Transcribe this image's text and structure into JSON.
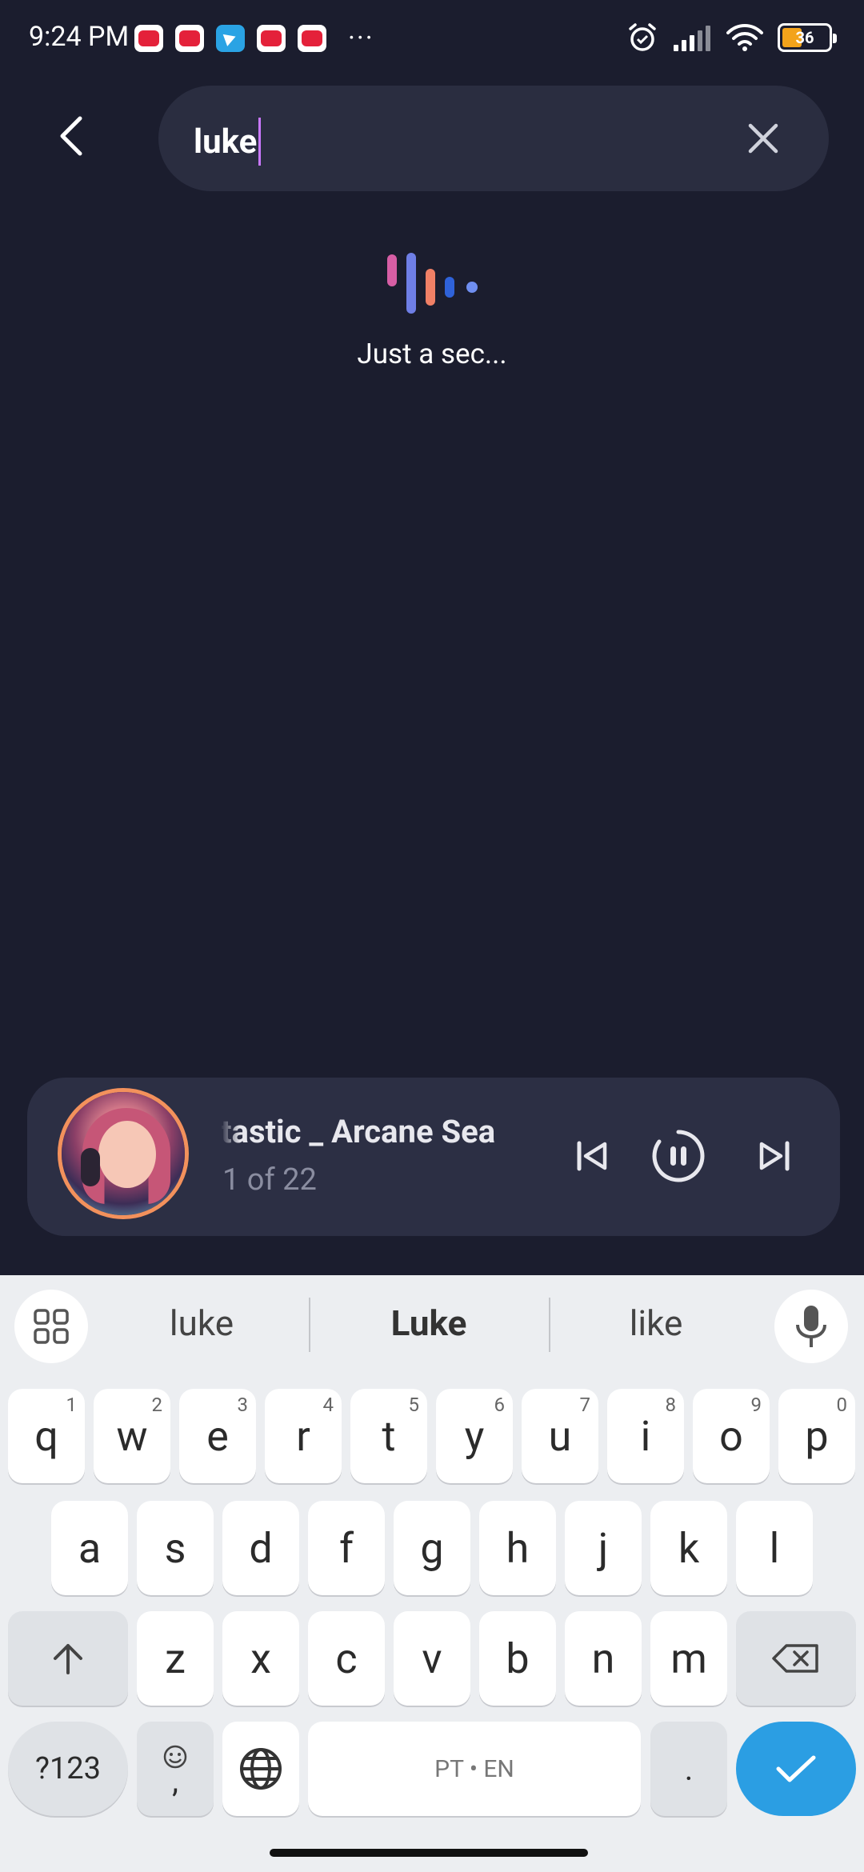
{
  "status_bar": {
    "time": "9:24 PM",
    "notifications": [
      "youtube-icon",
      "youtube-icon",
      "telegram-icon",
      "youtube-icon",
      "youtube-icon"
    ],
    "more": "···",
    "battery_level": "36"
  },
  "search": {
    "value": "luke"
  },
  "loading": {
    "text": "Just a sec..."
  },
  "player": {
    "track_title": "tastic _ Arcane Sea",
    "track_position": "1 of 22",
    "accent_ring_color": "#f3915c"
  },
  "keyboard": {
    "suggestions": [
      "luke",
      "Luke",
      "like"
    ],
    "row1": [
      {
        "label": "q",
        "hint": "1"
      },
      {
        "label": "w",
        "hint": "2"
      },
      {
        "label": "e",
        "hint": "3"
      },
      {
        "label": "r",
        "hint": "4"
      },
      {
        "label": "t",
        "hint": "5"
      },
      {
        "label": "y",
        "hint": "6"
      },
      {
        "label": "u",
        "hint": "7"
      },
      {
        "label": "i",
        "hint": "8"
      },
      {
        "label": "o",
        "hint": "9"
      },
      {
        "label": "p",
        "hint": "0"
      }
    ],
    "row2": [
      "a",
      "s",
      "d",
      "f",
      "g",
      "h",
      "j",
      "k",
      "l"
    ],
    "row3": [
      "z",
      "x",
      "c",
      "v",
      "b",
      "n",
      "m"
    ],
    "symbols_label": "?123",
    "emoji_comma": ",",
    "space_label": "PT • EN",
    "period": "."
  }
}
